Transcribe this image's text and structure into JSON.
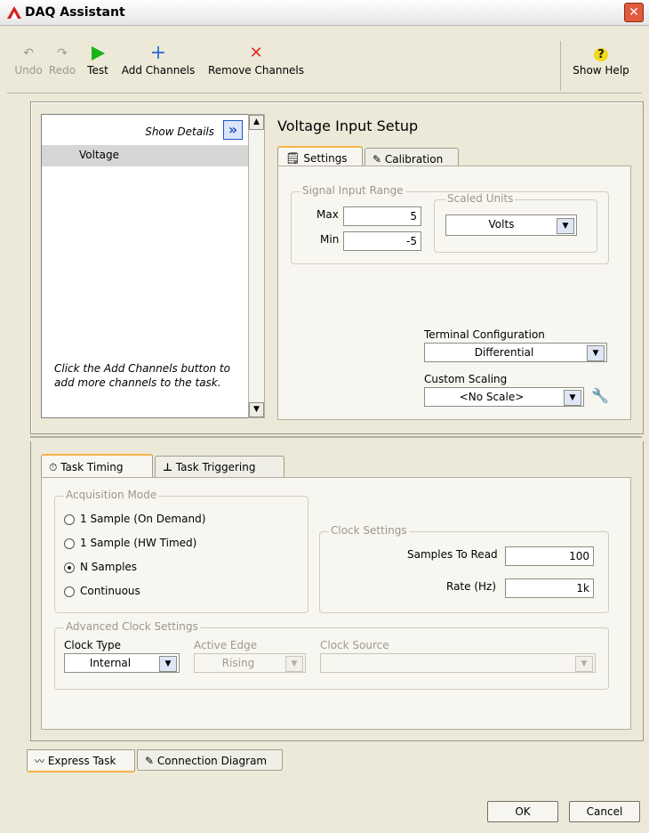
{
  "window": {
    "title": "DAQ Assistant",
    "close_glyph": "✕"
  },
  "toolbar": {
    "undo": "Undo",
    "redo": "Redo",
    "test": "Test",
    "add_channels": "Add Channels",
    "remove_channels": "Remove Channels",
    "show_help": "Show Help"
  },
  "channels": {
    "show_details": "Show Details",
    "show_details_glyph": "»",
    "items": [
      "Voltage"
    ],
    "hint_line1": "Click the Add Channels button to",
    "hint_line2": "add more channels to the task."
  },
  "setup": {
    "title": "Voltage Input Setup",
    "tabs": [
      "Settings",
      "Calibration"
    ],
    "signal_range": {
      "label": "Signal Input Range",
      "max_label": "Max",
      "max_value": "5",
      "min_label": "Min",
      "min_value": "-5"
    },
    "scaled_units": {
      "label": "Scaled Units",
      "value": "Volts"
    },
    "terminal": {
      "label": "Terminal Configuration",
      "value": "Differential"
    },
    "custom_scaling": {
      "label": "Custom Scaling",
      "value": "<No Scale>"
    }
  },
  "timing": {
    "tabs": [
      "Task Timing",
      "Task Triggering"
    ],
    "acquisition": {
      "label": "Acquisition Mode",
      "options": [
        "1 Sample (On Demand)",
        "1 Sample (HW Timed)",
        "N Samples",
        "Continuous"
      ],
      "selected": "N Samples"
    },
    "clock_settings": {
      "label": "Clock Settings",
      "samples_label": "Samples To Read",
      "samples_value": "100",
      "rate_label": "Rate (Hz)",
      "rate_value": "1k"
    },
    "advanced": {
      "label": "Advanced Clock Settings",
      "clock_type_label": "Clock Type",
      "clock_type_value": "Internal",
      "edge_label": "Active Edge",
      "edge_value": "Rising",
      "source_label": "Clock Source",
      "source_value": ""
    }
  },
  "bottom_tabs": [
    "Express Task",
    "Connection Diagram"
  ],
  "buttons": {
    "ok": "OK",
    "cancel": "Cancel"
  },
  "colors": {
    "accent_tab": "#f6b34b",
    "test_green": "#17b317",
    "add_blue": "#2f6fd6",
    "remove_red": "#e02d2d",
    "help_yellow": "#f2d81b"
  }
}
